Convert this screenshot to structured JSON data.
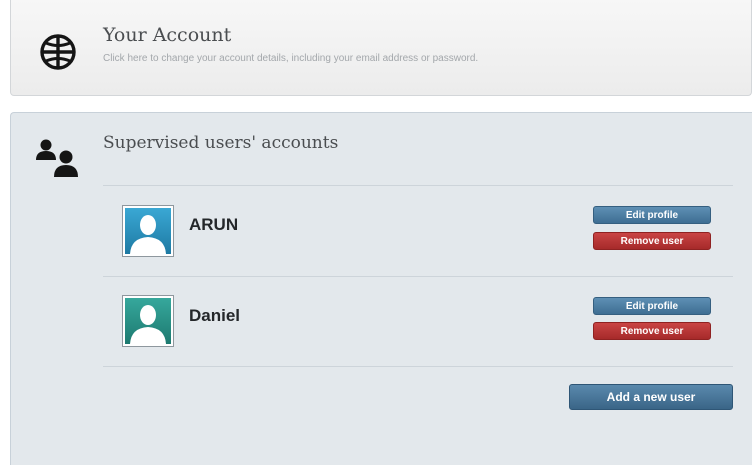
{
  "account": {
    "title": "Your Account",
    "description": "Click here to change your account details, including your email address or password.",
    "icon": "globe-icon"
  },
  "supervised": {
    "title": "Supervised users' accounts",
    "icon": "users-icon",
    "users": [
      {
        "name": "ARUN",
        "avatar_color": "#2b8fb8",
        "edit_label": "Edit profile",
        "remove_label": "Remove user"
      },
      {
        "name": "Daniel",
        "avatar_color": "#2a8f85",
        "edit_label": "Edit profile",
        "remove_label": "Remove user"
      }
    ],
    "add_label": "Add a new user"
  },
  "colors": {
    "edit_button": "#4a7ba1",
    "remove_button": "#b83636",
    "add_button": "#4a779b"
  }
}
